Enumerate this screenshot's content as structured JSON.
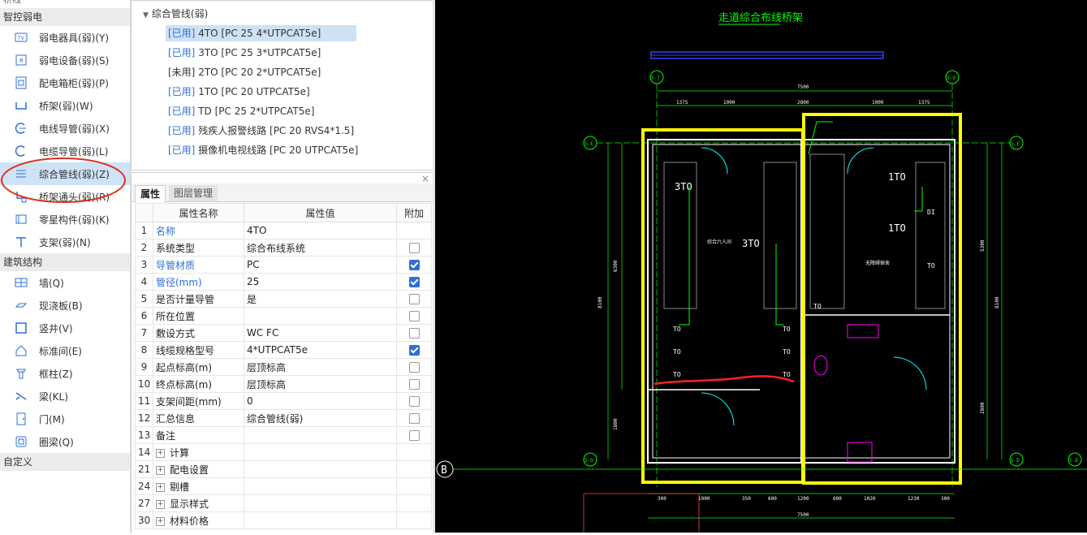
{
  "nav": {
    "partial_top": "桥线",
    "sections": [
      {
        "title": "智控弱电",
        "items": [
          {
            "label": "弱电器具(弱)(Y)",
            "icon": "tv-icon"
          },
          {
            "label": "弱电设备(弱)(S)",
            "icon": "device-r-icon"
          },
          {
            "label": "配电箱柜(弱)(P)",
            "icon": "cabinet-icon"
          },
          {
            "label": "桥架(弱)(W)",
            "icon": "cable-tray-icon"
          },
          {
            "label": "电线导管(弱)(X)",
            "icon": "wire-conduit-icon"
          },
          {
            "label": "电缆导管(弱)(L)",
            "icon": "cable-conduit-icon"
          },
          {
            "label": "综合管线(弱)(Z)",
            "icon": "integrated-pipeline-icon"
          },
          {
            "label": "桥架通头(弱)(R)",
            "icon": "tray-fitting-icon"
          },
          {
            "label": "零星构件(弱)(K)",
            "icon": "misc-component-icon"
          },
          {
            "label": "支架(弱)(N)",
            "icon": "bracket-icon"
          }
        ]
      },
      {
        "title": "建筑结构",
        "items": [
          {
            "label": "墙(Q)",
            "icon": "wall-icon"
          },
          {
            "label": "现浇板(B)",
            "icon": "slab-icon"
          },
          {
            "label": "竖井(V)",
            "icon": "shaft-icon"
          },
          {
            "label": "标准间(E)",
            "icon": "standard-room-icon"
          },
          {
            "label": "框柱(Z)",
            "icon": "column-icon"
          },
          {
            "label": "梁(KL)",
            "icon": "beam-icon"
          },
          {
            "label": "门(M)",
            "icon": "door-icon"
          },
          {
            "label": "圈梁(Q)",
            "icon": "ring-beam-icon"
          }
        ]
      },
      {
        "title": "自定义",
        "items": []
      }
    ]
  },
  "tree": {
    "header": "综合管线(弱)",
    "items": [
      {
        "status": "[已用]",
        "text": "4TO [PC 25 4*UTPCAT5e]",
        "used": true
      },
      {
        "status": "[已用]",
        "text": "3TO [PC 25 3*UTPCAT5e]",
        "used": true
      },
      {
        "status": "[未用]",
        "text": "2TO [PC 20 2*UTPCAT5e]",
        "used": false
      },
      {
        "status": "[已用]",
        "text": "1TO [PC 20 UTPCAT5e]",
        "used": true
      },
      {
        "status": "[已用]",
        "text": "TD [PC 25 2*UTPCAT5e]",
        "used": true
      },
      {
        "status": "[已用]",
        "text": "残疾人报警线路 [PC 20 RVS4*1.5]",
        "used": true
      },
      {
        "status": "[已用]",
        "text": "摄像机电视线路 [PC 20 UTPCAT5e]",
        "used": true
      }
    ]
  },
  "props": {
    "close": "×",
    "tabs": [
      "属性",
      "图层管理"
    ],
    "columns": [
      "属性名称",
      "属性值",
      "附加"
    ],
    "rows": [
      {
        "no": "1",
        "name": "名称",
        "value": "4TO",
        "blue": true,
        "check": null
      },
      {
        "no": "2",
        "name": "系统类型",
        "value": "综合布线系统",
        "blue": false,
        "check": false
      },
      {
        "no": "3",
        "name": "导管材质",
        "value": "PC",
        "blue": true,
        "check": true
      },
      {
        "no": "4",
        "name": "管径(mm)",
        "value": "25",
        "blue": true,
        "check": true
      },
      {
        "no": "5",
        "name": "是否计量导管",
        "value": "是",
        "blue": false,
        "check": false
      },
      {
        "no": "6",
        "name": "所在位置",
        "value": "",
        "blue": false,
        "check": false
      },
      {
        "no": "7",
        "name": "敷设方式",
        "value": "WC FC",
        "blue": false,
        "check": false
      },
      {
        "no": "8",
        "name": "线缆规格型号",
        "value": "4*UTPCAT5e",
        "blue": false,
        "check": true
      },
      {
        "no": "9",
        "name": "起点标高(m)",
        "value": "层顶标高",
        "blue": false,
        "check": false
      },
      {
        "no": "10",
        "name": "终点标高(m)",
        "value": "层顶标高",
        "blue": false,
        "check": false
      },
      {
        "no": "11",
        "name": "支架间距(mm)",
        "value": "0",
        "blue": false,
        "check": false
      },
      {
        "no": "12",
        "name": "汇总信息",
        "value": "综合管线(弱)",
        "blue": false,
        "check": false
      },
      {
        "no": "13",
        "name": "备注",
        "value": "",
        "blue": false,
        "check": false
      },
      {
        "no": "14",
        "name": "计算",
        "value": "",
        "blue": false,
        "check": null,
        "group": true
      },
      {
        "no": "21",
        "name": "配电设置",
        "value": "",
        "blue": false,
        "check": null,
        "group": true
      },
      {
        "no": "24",
        "name": "剔槽",
        "value": "",
        "blue": false,
        "check": null,
        "group": true
      },
      {
        "no": "27",
        "name": "显示样式",
        "value": "",
        "blue": false,
        "check": null,
        "group": true
      },
      {
        "no": "30",
        "name": "材料价格",
        "value": "",
        "blue": false,
        "check": null,
        "group": true
      }
    ]
  },
  "cad": {
    "title": "走道综合布线桥架",
    "grid_labels": [
      "5-7",
      "5-9",
      "5-E",
      "5-E",
      "5-D",
      "5-D",
      "5-D",
      "B"
    ],
    "dims_top": [
      "7500",
      "1375",
      "1000",
      "2800",
      "1000",
      "1375"
    ],
    "dims_bottom": [
      "300",
      "1900",
      "350",
      "600",
      "1200",
      "600",
      "1020",
      "1230",
      "300",
      "7500"
    ],
    "dims_side": [
      "8100",
      "6300",
      "1800",
      "5300",
      "2800",
      "8100"
    ],
    "room_labels": [
      "综合六人间",
      "无障碍宿舍"
    ],
    "outlet_labels": [
      "3TO",
      "3TO",
      "1TO",
      "1TO",
      "TO",
      "TO",
      "TO",
      "TO",
      "TO",
      "TO",
      "TO",
      "DI",
      "TO"
    ],
    "colors": {
      "background": "#000000",
      "wall": "#ffffff",
      "highlight": "#ffff00",
      "green": "#00ff00",
      "cyan": "#00ffff",
      "red": "#ff0000",
      "magenta": "#ff00ff",
      "blue": "#3b3bff"
    }
  }
}
